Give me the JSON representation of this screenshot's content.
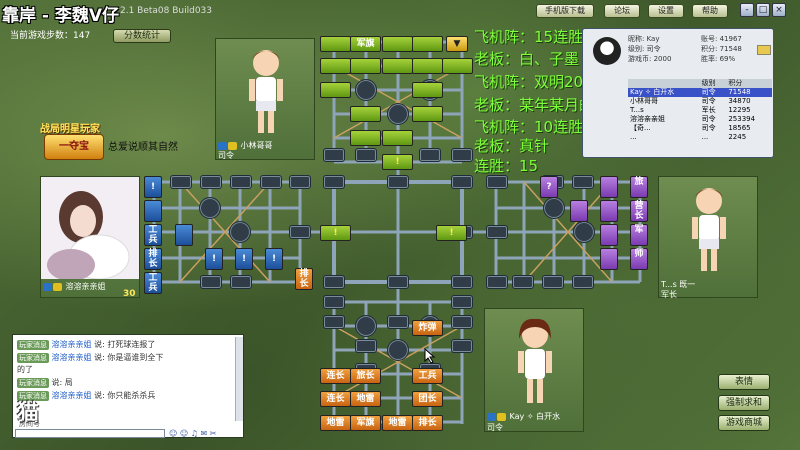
{
  "stream_title": "靠岸 - 李魏V仔",
  "version": "2.1 Beta08 Build033",
  "steps": {
    "label": "当前游戏步数：",
    "value": "147"
  },
  "score_stats_button": "分数统计",
  "top_buttons": [
    "手机版下载",
    "论坛",
    "设置",
    "帮助"
  ],
  "window_buttons": [
    "-",
    "□",
    "×"
  ],
  "overlay_lines": [
    "飞机阵：15连胜",
    "老板：白、子墨",
    "飞机阵：双明20连胜兵秦打",
    "老板：某年某月的缘",
    "飞机阵：10连胜",
    "老板：真针",
    "连胜：15"
  ],
  "players": {
    "top": {
      "rank": "司令",
      "name": "小林哥哥"
    },
    "left": {
      "rank": "",
      "name": "溶溶亲亲姐",
      "count": "30",
      "vip_caption": "总爱说顺其自然",
      "vip_title": "战局明星玩家",
      "vip_badge": "一夺宝"
    },
    "right": {
      "name": "T...s",
      "rank": "军长",
      "extra": "既一"
    },
    "bottom": {
      "rank": "司令",
      "name": "Kay ✧ 白开水"
    }
  },
  "profile": {
    "nick_label": "昵称:",
    "nick": "Kay",
    "level_label": "级别:",
    "level": "司令",
    "coins_label": "游戏币:",
    "coins": "2000",
    "id_label": "账号:",
    "id": "41967",
    "points_label": "积分:",
    "points": "71548",
    "winrate_label": "胜率:",
    "winrate": "69%"
  },
  "rank_table": {
    "headers": [
      "",
      "级别",
      "积分"
    ],
    "rows": [
      [
        "Kay ✧ 白开水",
        "司令",
        "71548"
      ],
      [
        "小林哥哥",
        "司令",
        "34870"
      ],
      [
        "T...s",
        "军长",
        "12295"
      ],
      [
        "溶溶亲亲姐",
        "司令",
        "253394"
      ],
      [
        "【奇...",
        "司令",
        "18565"
      ],
      [
        "...",
        "...",
        "2245"
      ]
    ]
  },
  "board_pieces": {
    "top": [
      "军旗",
      "▼",
      "!",
      "!",
      "!"
    ],
    "left": [
      "!",
      "!",
      "排长",
      "!",
      "!",
      "!",
      "!",
      "!"
    ],
    "left_vertical": [
      "工兵",
      "排长",
      "工兵"
    ],
    "right": [
      "旅",
      "营长",
      "军",
      "师"
    ],
    "right_q": "?",
    "bottom": [
      [
        "炸弹"
      ],
      [
        "连长",
        "旅长",
        "工兵"
      ],
      [
        "连长",
        "地雷",
        "团长"
      ],
      [
        "地雷",
        "军旗",
        "地雷",
        "排长"
      ]
    ]
  },
  "chat": {
    "lines": [
      {
        "tag": "玩家消息",
        "name": "溶溶亲亲姐",
        "verb": "说:",
        "text": "打死球连报了"
      },
      {
        "tag": "玩家消息",
        "name": "溶溶亲亲姐",
        "verb": "说:",
        "text": "你是逼谁到全下"
      },
      {
        "tag": "",
        "name": "",
        "verb": "",
        "text": "的了"
      },
      {
        "tag": "玩家消息",
        "name": "",
        "verb": "说:",
        "text": "局"
      },
      {
        "tag": "玩家消息",
        "name": "溶溶亲亲姐",
        "verb": "说:",
        "text": "你只能杀杀兵"
      }
    ],
    "room_label": "房间号",
    "watermark": "猫"
  },
  "bottom_right_buttons": [
    "表情",
    "强制求和",
    "游戏商城"
  ]
}
